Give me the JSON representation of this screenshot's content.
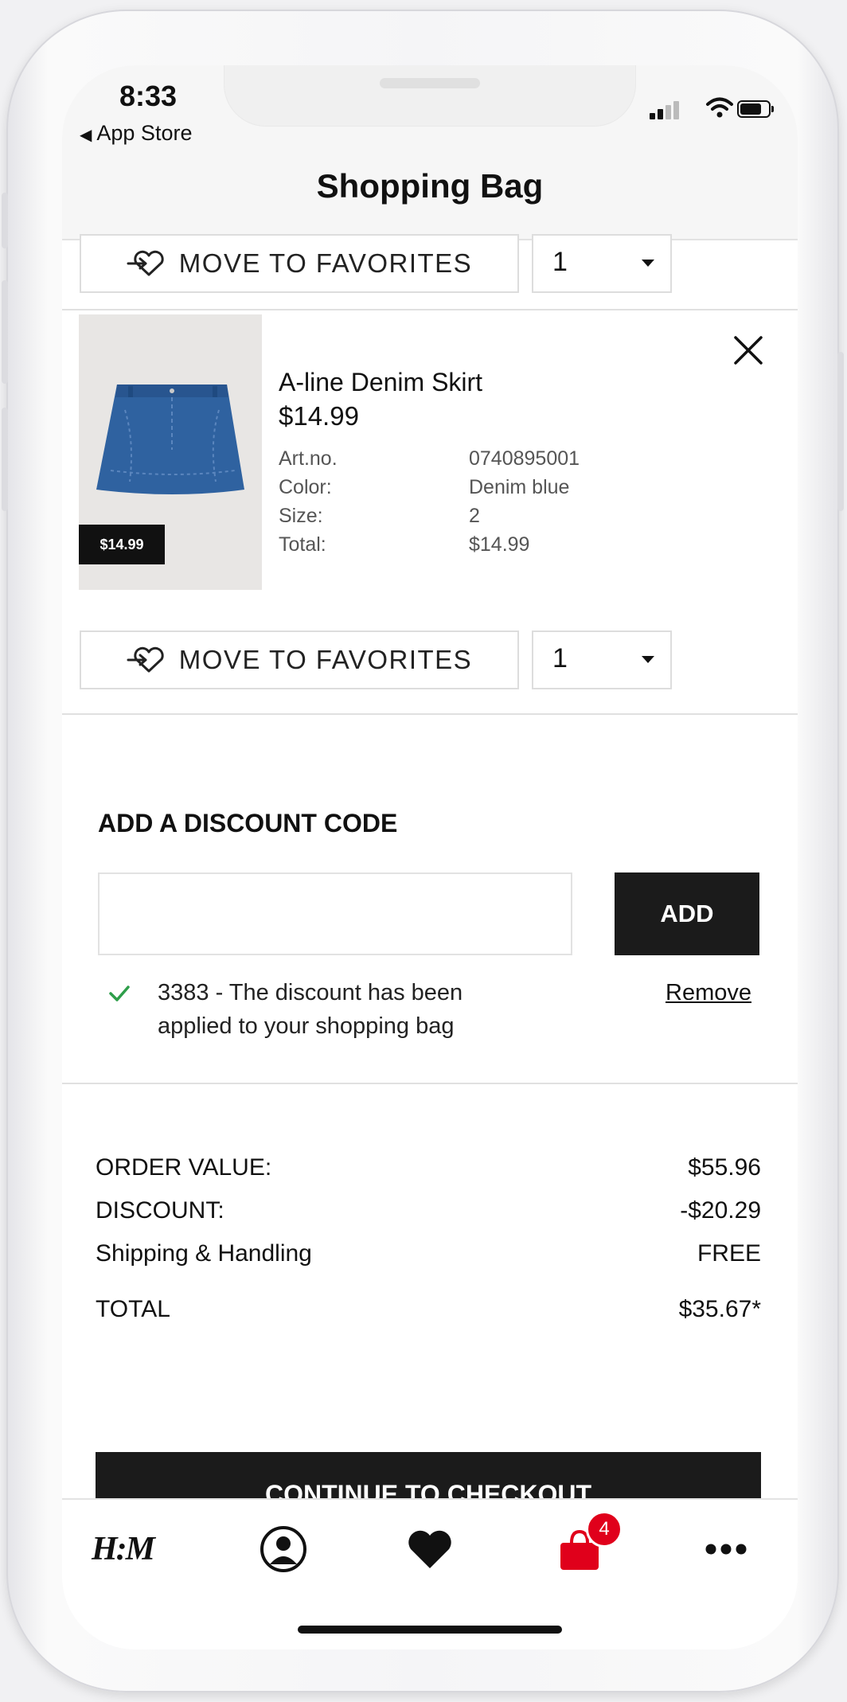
{
  "status_bar": {
    "time": "8:33",
    "back_app": "App Store"
  },
  "header": {
    "title": "Shopping Bag"
  },
  "prev_item": {
    "favorites_label": "MOVE TO FAVORITES",
    "quantity": "1"
  },
  "item": {
    "name": "A-line Denim Skirt",
    "price": "$14.99",
    "price_tag": "$14.99",
    "attributes": [
      {
        "label": "Art.no.",
        "value": "0740895001"
      },
      {
        "label": "Color:",
        "value": "Denim blue"
      },
      {
        "label": "Size:",
        "value": "2"
      },
      {
        "label": "Total:",
        "value": "$14.99"
      }
    ],
    "favorites_label": "MOVE TO FAVORITES",
    "quantity": "1"
  },
  "discount": {
    "heading": "ADD A DISCOUNT CODE",
    "input_value": "",
    "add_label": "ADD",
    "applied_message": "3383 - The discount has been applied to your shopping bag",
    "remove_label": "Remove"
  },
  "summary": {
    "order_value": {
      "label": "ORDER VALUE:",
      "value": "$55.96"
    },
    "discount": {
      "label": "DISCOUNT:",
      "value": "-$20.29"
    },
    "shipping": {
      "label": "Shipping & Handling",
      "value": "FREE"
    },
    "total": {
      "label": "TOTAL",
      "value": "$35.67*"
    }
  },
  "checkout_label": "CONTINUE TO CHECKOUT",
  "tabbar": {
    "logo": "H:M",
    "bag_count": "4",
    "icons": [
      "hm-logo-icon",
      "account-icon",
      "heart-icon",
      "shopping-bag-icon",
      "more-icon"
    ]
  },
  "colors": {
    "accent": "#e0001b",
    "button": "#1b1b1b",
    "check": "#2e9e4a",
    "denim": "#2f62a0"
  }
}
